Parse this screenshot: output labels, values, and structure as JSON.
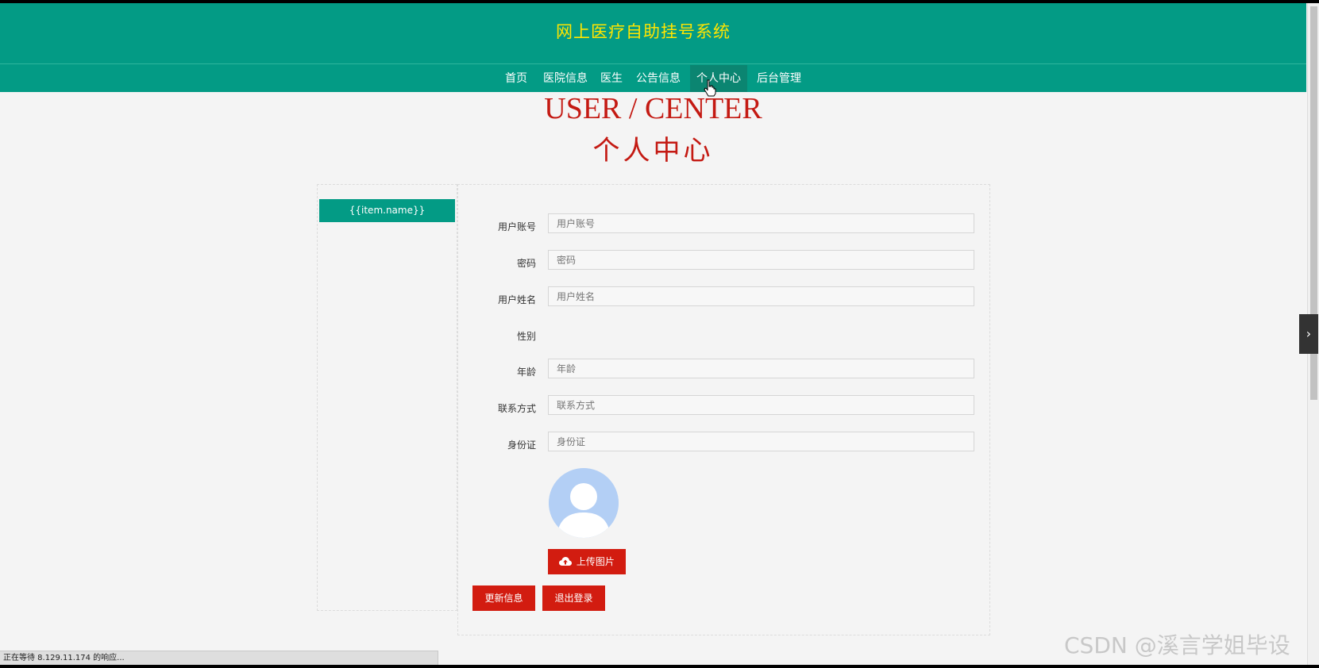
{
  "header": {
    "site_title": "网上医疗自助挂号系统",
    "nav": [
      "首页",
      "医院信息",
      "医生",
      "公告信息",
      "个人中心",
      "后台管理"
    ],
    "active_nav": "个人中心"
  },
  "page": {
    "heading_en": "USER / CENTER",
    "heading_cn": "个人中心"
  },
  "sidebar": {
    "items": [
      {
        "label": "{{item.name}}"
      }
    ]
  },
  "form": {
    "fields": [
      {
        "label": "用户账号",
        "placeholder": "用户账号"
      },
      {
        "label": "密码",
        "placeholder": "密码"
      },
      {
        "label": "用户姓名",
        "placeholder": "用户姓名"
      },
      {
        "label": "性别"
      },
      {
        "label": "年龄",
        "placeholder": "年龄"
      },
      {
        "label": "联系方式",
        "placeholder": "联系方式"
      },
      {
        "label": "身份证",
        "placeholder": "身份证"
      }
    ],
    "upload_label": "上传图片",
    "update_label": "更新信息",
    "logout_label": "退出登录"
  },
  "status_bar": "正在等待 8.129.11.174 的响应...",
  "watermark": "CSDN @溪言学姐毕设",
  "colors": {
    "primary": "#039b85",
    "accent": "#d21c10",
    "title": "#ffe500"
  }
}
